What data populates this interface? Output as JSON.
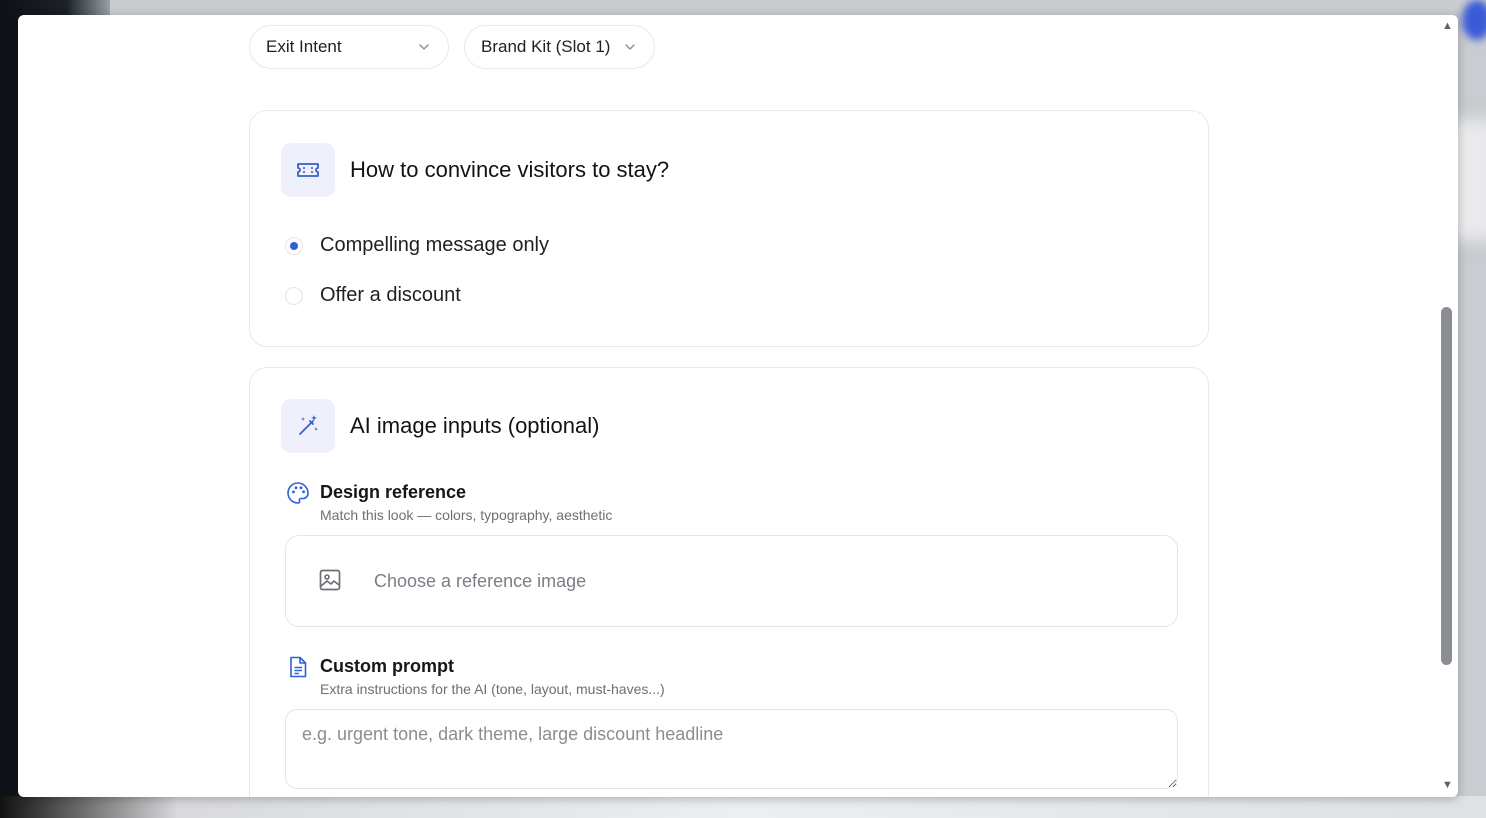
{
  "filters": {
    "trigger": "Exit Intent",
    "brand_kit": "Brand Kit (Slot 1)"
  },
  "convince_section": {
    "title": "How to convince visitors to stay?",
    "icon": "ticket-icon",
    "options": [
      {
        "label": "Compelling message only",
        "selected": true
      },
      {
        "label": "Offer a discount",
        "selected": false
      }
    ]
  },
  "ai_section": {
    "title": "AI image inputs (optional)",
    "icon": "magic-wand-icon",
    "design_reference": {
      "title": "Design reference",
      "subtitle": "Match this look — colors, typography, aesthetic",
      "icon": "palette-icon",
      "upload_label": "Choose a reference image",
      "upload_icon": "image-icon"
    },
    "custom_prompt": {
      "title": "Custom prompt",
      "subtitle": "Extra instructions for the AI (tone, layout, must-haves...)",
      "icon": "document-icon",
      "placeholder": "e.g. urgent tone, dark theme, large discount headline",
      "value": ""
    }
  },
  "colors": {
    "accent": "#2f5fd6",
    "icon_bg": "#eef0fb"
  }
}
